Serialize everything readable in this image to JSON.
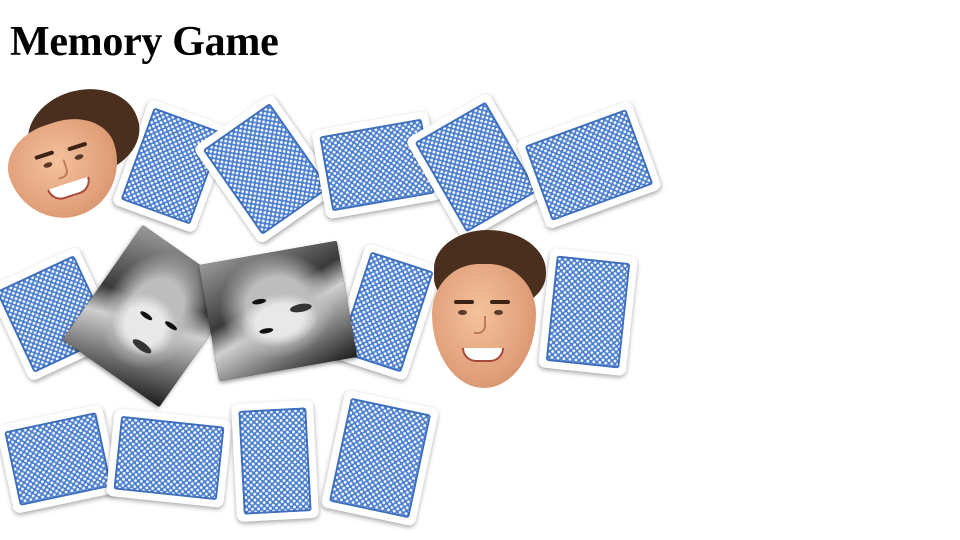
{
  "title": "Memory Game",
  "cards": [
    {
      "id": 1,
      "state": "face-down"
    },
    {
      "id": 2,
      "state": "face-down"
    },
    {
      "id": 3,
      "state": "face-down"
    },
    {
      "id": 4,
      "state": "face-down"
    },
    {
      "id": 5,
      "state": "face-down"
    },
    {
      "id": 6,
      "state": "face-down"
    },
    {
      "id": 7,
      "state": "face-down"
    },
    {
      "id": 8,
      "state": "face-down"
    },
    {
      "id": 9,
      "state": "face-down"
    },
    {
      "id": 10,
      "state": "face-down"
    },
    {
      "id": 11,
      "state": "face-down"
    },
    {
      "id": 12,
      "state": "face-down"
    },
    {
      "id": 13,
      "state": "face-down"
    },
    {
      "id": 14,
      "state": "face-down"
    },
    {
      "id": 15,
      "state": "face-up",
      "image": "man-face"
    },
    {
      "id": 16,
      "state": "face-up",
      "image": "man-face"
    },
    {
      "id": 17,
      "state": "face-up",
      "image": "woman-portrait"
    },
    {
      "id": 18,
      "state": "face-up",
      "image": "woman-portrait"
    }
  ],
  "colors": {
    "card_back": "#4a7fd0",
    "card_border": "#ffffff",
    "background": "#ffffff"
  }
}
